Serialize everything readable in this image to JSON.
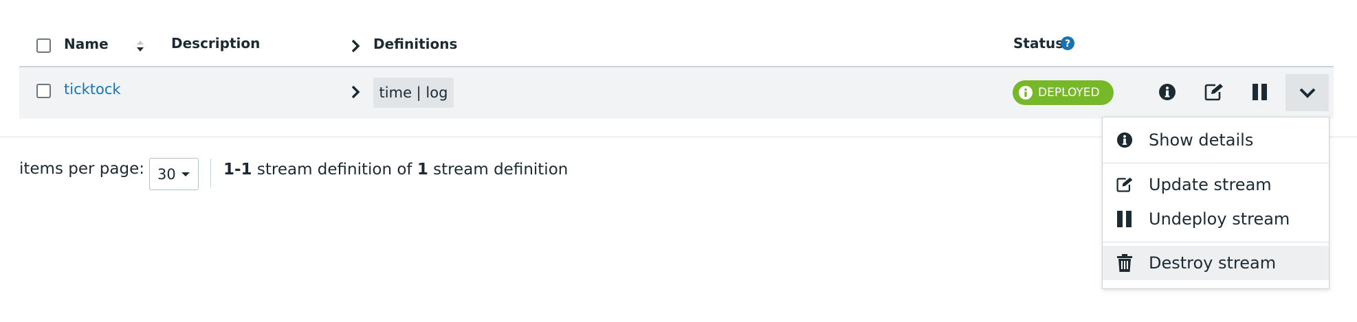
{
  "table": {
    "headers": {
      "name": "Name",
      "description": "Description",
      "definitions": "Definitions",
      "status": "Status"
    },
    "rows": [
      {
        "name": "ticktock",
        "description": "",
        "definition": "time | log",
        "status": "DEPLOYED"
      }
    ]
  },
  "pagination": {
    "items_per_page_label": "items per page:",
    "items_per_page_value": "30",
    "range": "1-1",
    "mid_text": "stream definition of",
    "total": "1",
    "tail_text": "stream definition"
  },
  "row_menu": {
    "items": [
      {
        "label": "Show details",
        "icon": "info-circle-icon"
      },
      {
        "label": "Update stream",
        "icon": "edit-icon"
      },
      {
        "label": "Undeploy stream",
        "icon": "pause-icon"
      },
      {
        "label": "Destroy stream",
        "icon": "trash-icon"
      }
    ]
  },
  "colors": {
    "link": "#1a73b0",
    "deployed_badge": "#76b82a",
    "row_background": "#f1f3f4",
    "text": "#1b2a33"
  }
}
